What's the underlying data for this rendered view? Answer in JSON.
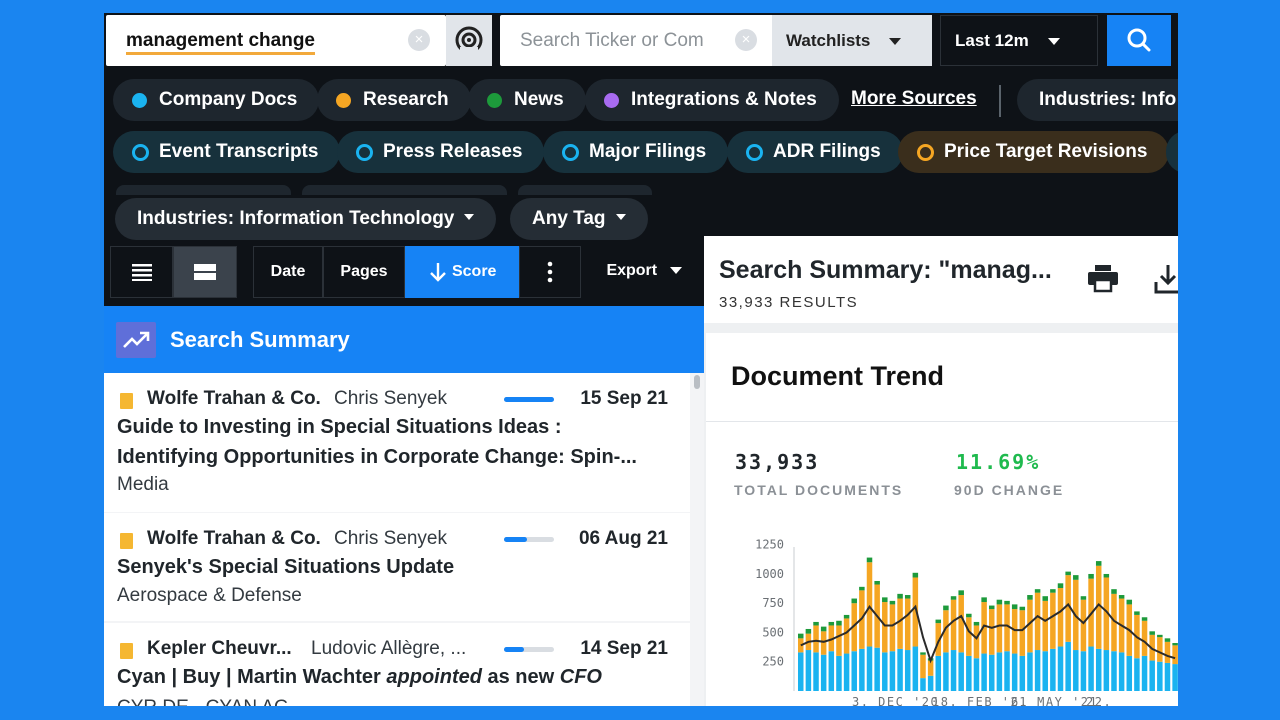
{
  "search": {
    "query": "management change",
    "ticker_placeholder": "Search Ticker or Com"
  },
  "watchlists": {
    "label": "Watchlists"
  },
  "period": {
    "label": "Last 12m"
  },
  "sources": [
    {
      "label": "Company Docs",
      "color": "#1ab3f0"
    },
    {
      "label": "Research",
      "color": "#f5a623"
    },
    {
      "label": "News",
      "color": "#1d9a3b"
    },
    {
      "label": "Integrations & Notes",
      "color": "#a86bf0"
    }
  ],
  "more_sources": "More Sources",
  "industries_clipped": "Industries: Info",
  "doc_types": [
    {
      "label": "Event Transcripts",
      "color": "#1ab3f0"
    },
    {
      "label": "Press Releases",
      "color": "#1ab3f0"
    },
    {
      "label": "Major Filings",
      "color": "#1ab3f0"
    },
    {
      "label": "ADR Filings",
      "color": "#1ab3f0"
    },
    {
      "label": "Price Target Revisions",
      "color": "#f5a623"
    }
  ],
  "filters": {
    "industries": "Industries: Information Technology",
    "tag": "Any Tag"
  },
  "toolbar": {
    "date": "Date",
    "pages": "Pages",
    "score": "Score",
    "export": "Export"
  },
  "summary_bar": {
    "label": "Search Summary"
  },
  "results": [
    {
      "source": "Wolfe Trahan & Co.",
      "author": "Chris Senyek",
      "score": 1.0,
      "date": "15 Sep 21",
      "title": "Guide to Investing in Special Situations Ideas : Identifying Opportunities in Corporate Change: Spin-...",
      "sector": "Media"
    },
    {
      "source": "Wolfe Trahan & Co.",
      "author": "Chris Senyek",
      "score": 0.45,
      "date": "06 Aug 21",
      "title": "Senyek's Special Situations Update",
      "sector": "Aerospace & Defense"
    },
    {
      "source": "Kepler Cheuvr...",
      "author": "Ludovic Allègre, ...",
      "score": 0.4,
      "date": "14 Sep 21",
      "title_parts": [
        "Cyan | Buy | Martin Wachter ",
        "appointed",
        " as new ",
        "CFO"
      ],
      "sector": "CYR DE - CYAN AG"
    }
  ],
  "panel": {
    "title": "Search Summary: \"manag...",
    "results": "33,933 RESULTS"
  },
  "trend": {
    "title": "Document Trend",
    "total": "33,933",
    "total_label": "TOTAL DOCUMENTS",
    "change": "11.69%",
    "change_label": "90D CHANGE",
    "change_color": "#1fba4e"
  },
  "chart_data": {
    "type": "bar",
    "stacked": true,
    "y_ticks": [
      "1250",
      "1000",
      "750",
      "500",
      "250"
    ],
    "ylim": [
      0,
      1350
    ],
    "x_tick_labels": [
      "3. DEC '20",
      "18. FEB '21",
      "6. MAY '21",
      "22."
    ],
    "series": [
      {
        "name": "Company Docs",
        "color": "#1ab3f0",
        "values": [
          330,
          350,
          330,
          310,
          340,
          300,
          320,
          340,
          360,
          380,
          370,
          330,
          340,
          360,
          350,
          380,
          110,
          130,
          300,
          330,
          350,
          330,
          300,
          280,
          320,
          310,
          330,
          340,
          320,
          300,
          330,
          350,
          340,
          360,
          380,
          420,
          350,
          340,
          380,
          360,
          350,
          340,
          330,
          300,
          280,
          300,
          260,
          250,
          240,
          230
        ]
      },
      {
        "name": "Research",
        "color": "#f5a623",
        "values": [
          120,
          140,
          230,
          200,
          220,
          260,
          300,
          410,
          500,
          720,
          540,
          430,
          400,
          430,
          440,
          590,
          200,
          130,
          280,
          360,
          430,
          490,
          330,
          280,
          440,
          390,
          410,
          400,
          380,
          390,
          450,
          490,
          430,
          480,
          500,
          570,
          600,
          440,
          580,
          710,
          620,
          490,
          460,
          440,
          370,
          300,
          220,
          210,
          180,
          160
        ]
      },
      {
        "name": "News",
        "color": "#1d9a3b",
        "values": [
          40,
          40,
          30,
          40,
          30,
          40,
          30,
          40,
          30,
          40,
          30,
          40,
          30,
          40,
          30,
          40,
          20,
          20,
          30,
          40,
          30,
          40,
          30,
          30,
          40,
          30,
          40,
          30,
          40,
          30,
          40,
          30,
          40,
          30,
          40,
          30,
          40,
          30,
          40,
          40,
          30,
          40,
          30,
          40,
          30,
          30,
          30,
          20,
          30,
          20
        ]
      },
      {
        "name": "Trend line",
        "color": "#2b2b2b",
        "kind": "line",
        "values": [
          390,
          420,
          430,
          420,
          440,
          470,
          500,
          560,
          620,
          720,
          640,
          560,
          560,
          600,
          650,
          720,
          460,
          260,
          420,
          540,
          600,
          640,
          510,
          450,
          560,
          540,
          560,
          560,
          520,
          520,
          580,
          640,
          600,
          640,
          680,
          740,
          640,
          580,
          660,
          740,
          680,
          600,
          560,
          520,
          460,
          420,
          360,
          330,
          300,
          280
        ]
      }
    ]
  }
}
